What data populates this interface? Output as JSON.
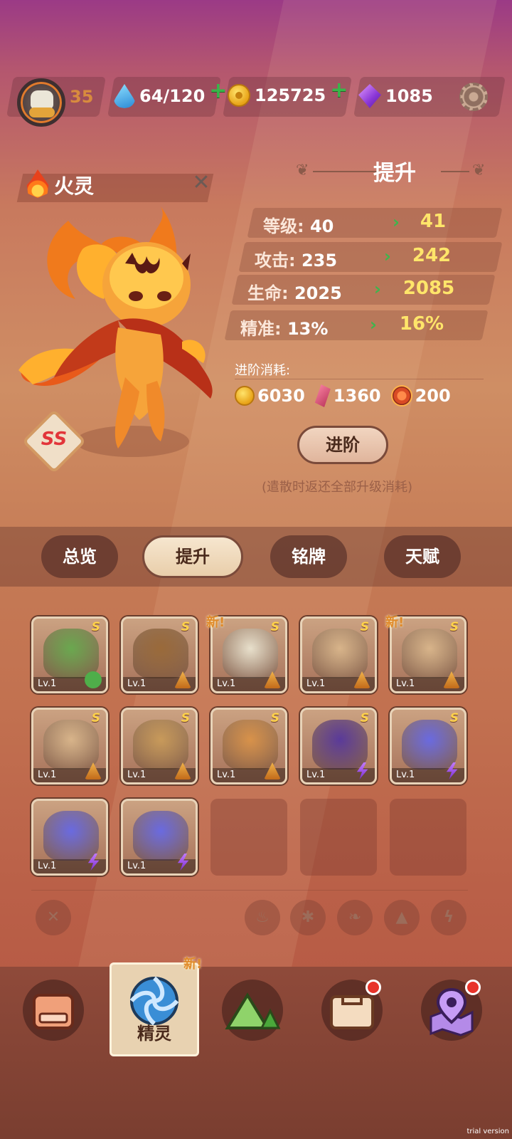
{
  "player": {
    "level": "35"
  },
  "resources": {
    "energy": "64/120",
    "coins": "125725",
    "gems": "1085"
  },
  "spirit": {
    "name": "火灵",
    "rank": "SS",
    "element_icon": "flame-icon"
  },
  "upgrade": {
    "title": "提升",
    "stats": [
      {
        "label": "等级:",
        "current": "40",
        "next": "41"
      },
      {
        "label": "攻击:",
        "current": "235",
        "next": "242"
      },
      {
        "label": "生命:",
        "current": "2025",
        "next": "2085"
      },
      {
        "label": "精准:",
        "current": "13%",
        "next": "16%"
      }
    ],
    "cost_label": "进阶消耗:",
    "costs": [
      {
        "icon": "coin-icon",
        "amount": "6030"
      },
      {
        "icon": "crystal-icon",
        "amount": "1360"
      },
      {
        "icon": "fire-orb-icon",
        "amount": "200"
      }
    ],
    "advance_label": "进阶",
    "note": "(遣散时返还全部升级消耗)"
  },
  "tabs": [
    {
      "label": "总览",
      "active": false
    },
    {
      "label": "提升",
      "active": true
    },
    {
      "label": "铭牌",
      "active": false
    },
    {
      "label": "天赋",
      "active": false
    }
  ],
  "roster": [
    {
      "creature": "monkey",
      "grade": "S",
      "level": "Lv.1",
      "element": "nature",
      "new": false
    },
    {
      "creature": "horned-spirit",
      "grade": "S",
      "level": "Lv.1",
      "element": "earth",
      "new": false
    },
    {
      "creature": "skull-beast",
      "grade": "S",
      "level": "Lv.1",
      "element": "earth",
      "new": true
    },
    {
      "creature": "antelope",
      "grade": "S",
      "level": "Lv.1",
      "element": "earth",
      "new": false
    },
    {
      "creature": "antelope",
      "grade": "S",
      "level": "Lv.1",
      "element": "earth",
      "new": true
    },
    {
      "creature": "antelope",
      "grade": "S",
      "level": "Lv.1",
      "element": "earth",
      "new": false
    },
    {
      "creature": "mud-blob",
      "grade": "S",
      "level": "Lv.1",
      "element": "earth",
      "new": false
    },
    {
      "creature": "corgi",
      "grade": "S",
      "level": "Lv.1",
      "element": "earth",
      "new": false
    },
    {
      "creature": "shadow-cat",
      "grade": "S",
      "level": "Lv.1",
      "element": "thunder",
      "new": false
    },
    {
      "creature": "jellyfish",
      "grade": "S",
      "level": "Lv.1",
      "element": "thunder",
      "new": false
    },
    {
      "creature": "jellyfish",
      "grade": "",
      "level": "Lv.1",
      "element": "thunder",
      "new": false
    },
    {
      "creature": "jellyfish",
      "grade": "",
      "level": "Lv.1",
      "element": "thunder",
      "new": false
    }
  ],
  "new_tag": "新!",
  "filters": [
    "close-filter-icon",
    "fire-filter-icon",
    "wind-filter-icon",
    "leaf-filter-icon",
    "earth-filter-icon",
    "thunder-filter-icon"
  ],
  "nav": [
    {
      "icon": "shop-icon",
      "label": "",
      "badge": false
    },
    {
      "icon": "spirit-icon",
      "label": "精灵",
      "badge": false,
      "active": true
    },
    {
      "icon": "mountain-icon",
      "label": "",
      "badge": false
    },
    {
      "icon": "chest-icon",
      "label": "",
      "badge": true
    },
    {
      "icon": "map-pin-icon",
      "label": "",
      "badge": true
    }
  ],
  "watermark": "trial version",
  "colors": {
    "accent_green": "#3fb54d",
    "value_yellow": "#ffe56a",
    "rank_red": "#e2353a",
    "badge_red": "#e8332a"
  }
}
